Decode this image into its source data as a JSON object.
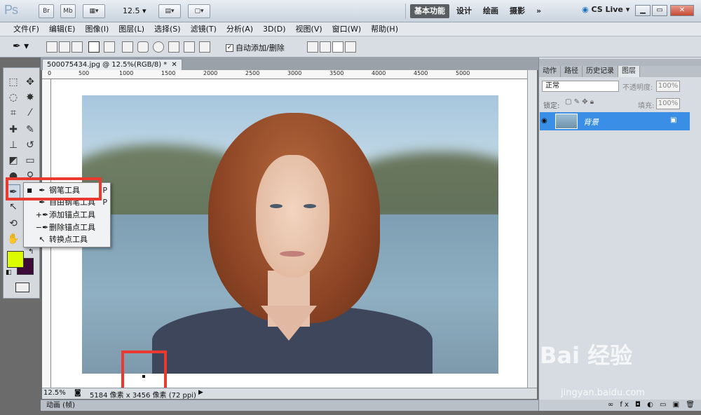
{
  "titlebar": {
    "app_logo": "Ps",
    "bridge": "Br",
    "minibridge": "Mb",
    "zoom": "12.5",
    "workspaces": [
      "基本功能",
      "设计",
      "绘画",
      "摄影"
    ],
    "more": "»",
    "cslive": "CS Live"
  },
  "menu": [
    "文件(F)",
    "编辑(E)",
    "图像(I)",
    "图层(L)",
    "选择(S)",
    "滤镜(T)",
    "分析(A)",
    "3D(D)",
    "视图(V)",
    "窗口(W)",
    "帮助(H)"
  ],
  "options": {
    "auto_add_delete": "自动添加/删除"
  },
  "document": {
    "tab_title": "500075434.jpg @ 12.5%(RGB/8) *",
    "ruler_labels": [
      "0",
      "500",
      "1000",
      "1500",
      "2000",
      "2500",
      "3000",
      "3500",
      "4000",
      "4500",
      "5000"
    ],
    "zoom_status": "12.5%",
    "doc_info": "5184 像素 x 3456 像素 (72 ppi)"
  },
  "flyout": [
    {
      "label": "钢笔工具",
      "shortcut": "P",
      "icon": "pen-icon",
      "selected": true
    },
    {
      "label": "自由钢笔工具",
      "shortcut": "P",
      "icon": "freeform-pen-icon",
      "selected": false
    },
    {
      "label": "添加锚点工具",
      "shortcut": "",
      "icon": "add-anchor-icon",
      "selected": false
    },
    {
      "label": "删除锚点工具",
      "shortcut": "",
      "icon": "delete-anchor-icon",
      "selected": false
    },
    {
      "label": "转换点工具",
      "shortcut": "",
      "icon": "convert-point-icon",
      "selected": false
    }
  ],
  "panel": {
    "tabs": [
      "动作",
      "路径",
      "历史记录",
      "图层"
    ],
    "blend_mode": "正常",
    "opacity_label": "不透明度:",
    "opacity_value": "100%",
    "lock_label": "锁定:",
    "fill_label": "填充:",
    "fill_value": "100%",
    "layer_name": "背景"
  },
  "animation_label": "动画 (帧)",
  "colors": {
    "foreground": "#dcfa00",
    "background": "#3d0a3a",
    "highlight": "#ea3a2f",
    "layer_selected": "#3a8ee6"
  },
  "watermark": {
    "brand": "Bai 经验",
    "url": "jingyan.baidu.com"
  }
}
